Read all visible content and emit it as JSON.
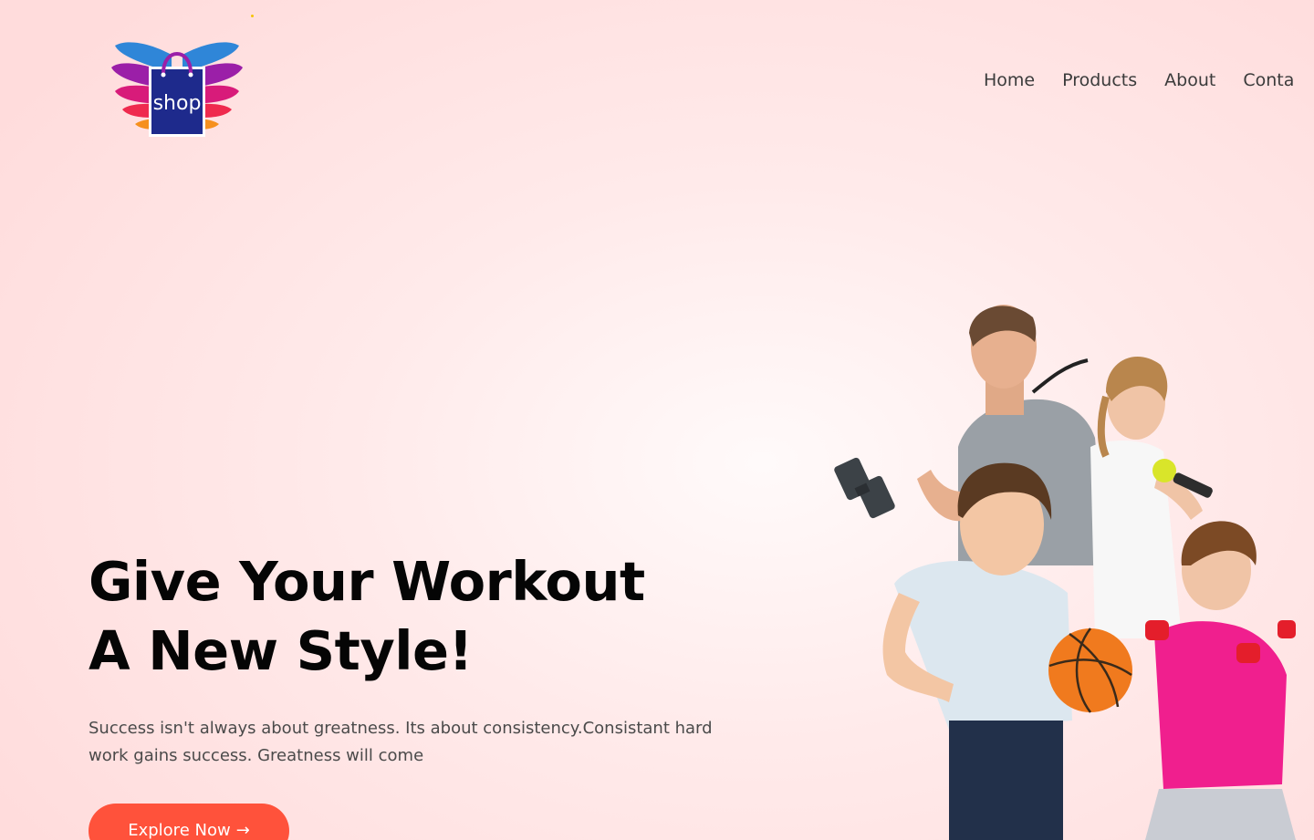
{
  "header": {
    "logo_text": "shop",
    "nav": [
      "Home",
      "Products",
      "About",
      "Conta"
    ]
  },
  "hero": {
    "title_line1": "Give Your Workout",
    "title_line2": "A New Style!",
    "description": "Success isn't always about greatness. Its about consistency.Consistant hard work gains success. Greatness will come",
    "button_label": "Explore Now",
    "button_arrow": "→"
  },
  "colors": {
    "accent": "#ff523b",
    "logo_bag": "#1e2a8c"
  }
}
